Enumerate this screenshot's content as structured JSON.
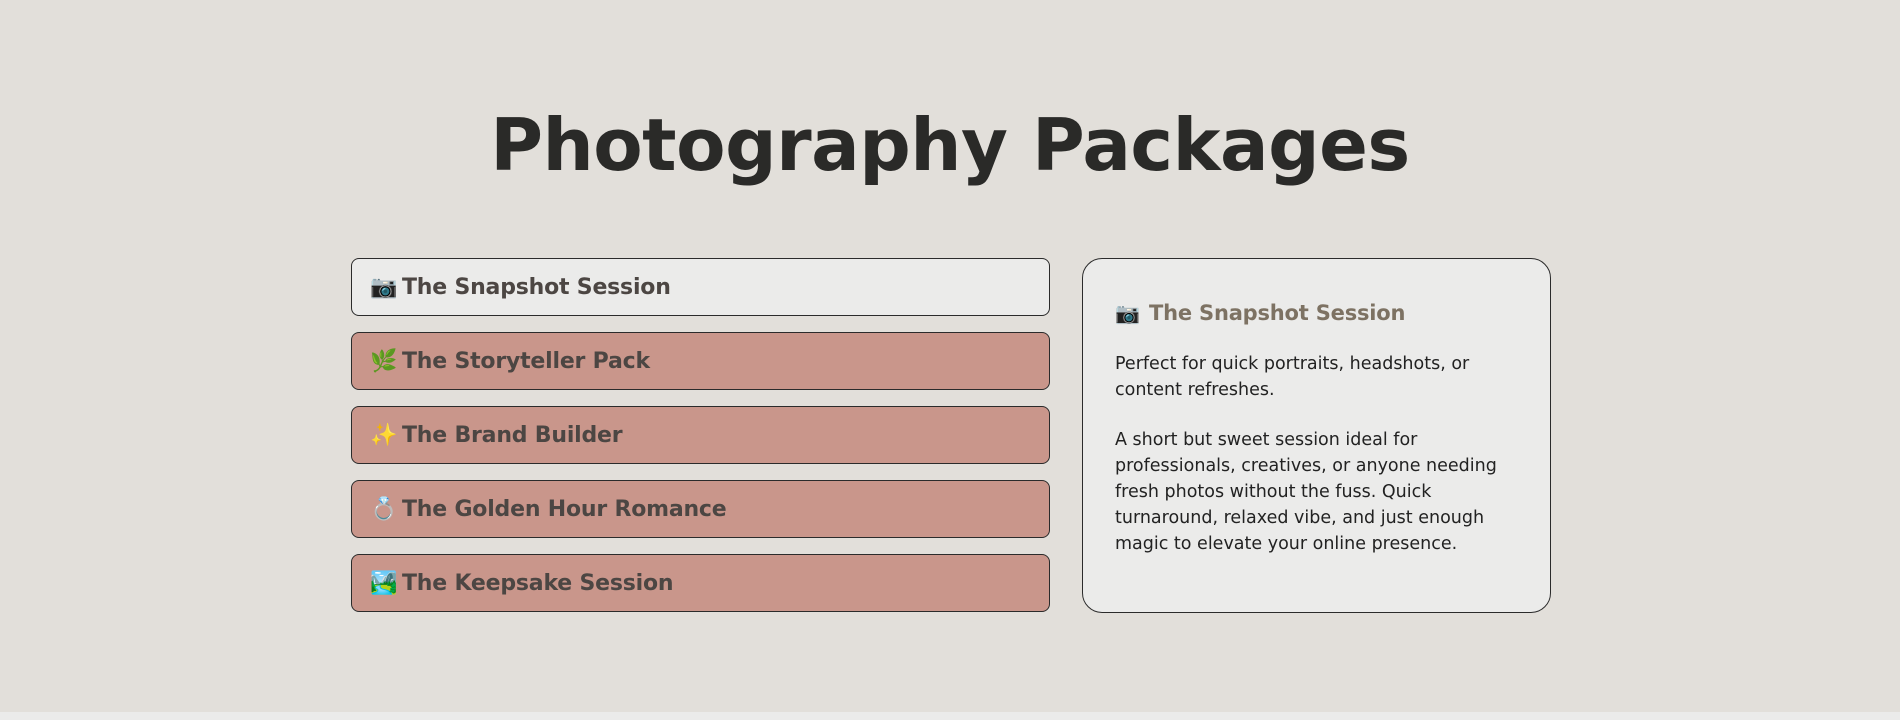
{
  "page": {
    "title": "Photography Packages"
  },
  "packages": [
    {
      "emoji": "📷",
      "label": "The Snapshot Session",
      "active": true
    },
    {
      "emoji": "🌿",
      "label": "The Storyteller Pack",
      "active": false
    },
    {
      "emoji": "✨",
      "label": "The Brand Builder",
      "active": false
    },
    {
      "emoji": "💍",
      "label": "The Golden Hour Romance",
      "active": false
    },
    {
      "emoji": "🏞️",
      "label": "The Keepsake Session",
      "active": false
    }
  ],
  "detail": {
    "emoji": "📷",
    "name": "The Snapshot Session",
    "paragraphs": [
      "Perfect for quick portraits, headshots, or content refreshes.",
      "A short but sweet session ideal for professionals, creatives, or anyone needing fresh photos without the fuss. Quick turnaround, relaxed vibe, and just enough magic to elevate your online presence."
    ]
  },
  "colors": {
    "background": "#e2dfda",
    "active_card": "#ebebea",
    "inactive_card": "#c9968b",
    "detail_title": "#7d7263",
    "heading": "#2a2a28"
  },
  "icons": {
    "snapshot": "camera-icon",
    "storyteller": "herb-icon",
    "brand": "sparkles-icon",
    "golden_hour": "ring-icon",
    "keepsake": "landscape-icon"
  }
}
